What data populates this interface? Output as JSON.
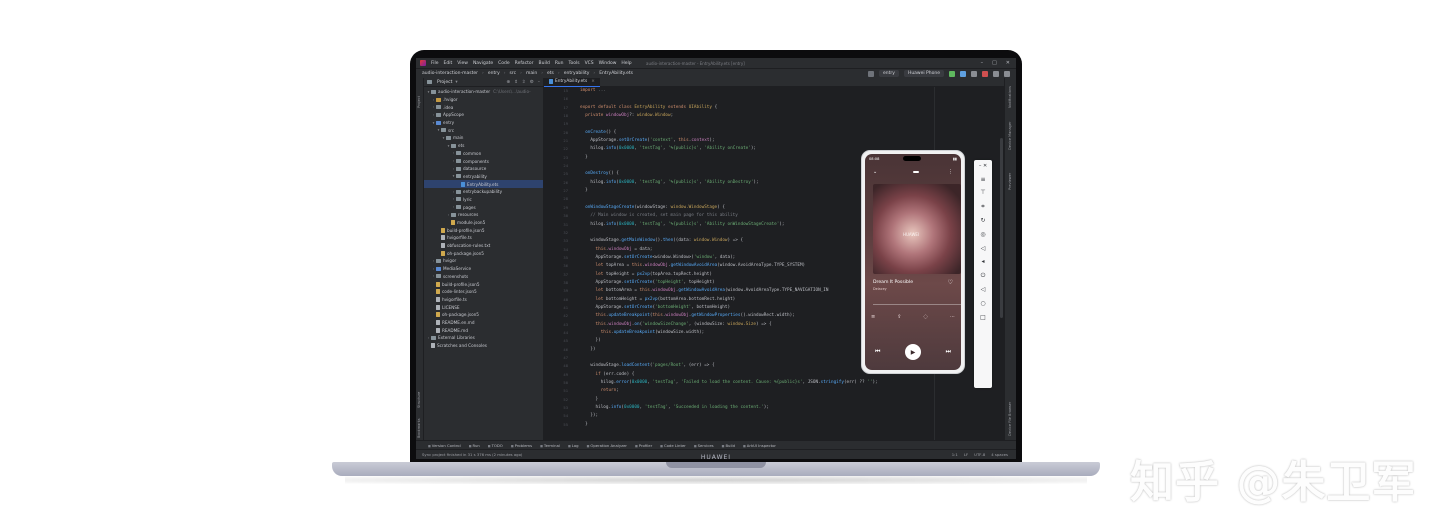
{
  "ide": {
    "menu": [
      "File",
      "Edit",
      "View",
      "Navigate",
      "Code",
      "Refactor",
      "Build",
      "Run",
      "Tools",
      "VCS",
      "Window",
      "Help"
    ],
    "window_title": "audio-interaction-master - EntryAbility.ets [entry]",
    "breadcrumb": [
      "audio-interaction-master",
      "entry",
      "src",
      "main",
      "ets",
      "entryability",
      "EntryAbility.ets"
    ],
    "run_config": "entry",
    "device": "Huawei Phone",
    "left_tools": [
      "Project",
      "Structure",
      "Bookmarks"
    ],
    "right_tools": [
      "Notifications",
      "Device Manager",
      "Previewer",
      "Device File Browser"
    ]
  },
  "project_panel": {
    "title": "Project",
    "tree": [
      {
        "label": "audio-interaction-master",
        "hint": "C:\\Users\\...\\audio-",
        "arrow": "▾",
        "icon": "folder",
        "indent": 0
      },
      {
        "label": ".hvigor",
        "arrow": "›",
        "icon": "folder-y",
        "indent": 1
      },
      {
        "label": ".idea",
        "arrow": "›",
        "icon": "folder",
        "indent": 1
      },
      {
        "label": "AppScope",
        "arrow": "›",
        "icon": "folder",
        "indent": 1
      },
      {
        "label": "entry",
        "arrow": "▾",
        "icon": "folder-b",
        "indent": 1
      },
      {
        "label": "src",
        "arrow": "▾",
        "icon": "folder",
        "indent": 2
      },
      {
        "label": "main",
        "arrow": "▾",
        "icon": "folder",
        "indent": 3
      },
      {
        "label": "ets",
        "arrow": "▾",
        "icon": "folder",
        "indent": 4
      },
      {
        "label": "common",
        "arrow": "›",
        "icon": "folder",
        "indent": 5
      },
      {
        "label": "components",
        "arrow": "›",
        "icon": "folder",
        "indent": 5
      },
      {
        "label": "datasource",
        "arrow": "›",
        "icon": "folder",
        "indent": 5
      },
      {
        "label": "entryability",
        "arrow": "▾",
        "icon": "folder",
        "indent": 5
      },
      {
        "label": "EntryAbility.ets",
        "arrow": "",
        "icon": "file-ts",
        "indent": 6,
        "selected": true
      },
      {
        "label": "entrybackupability",
        "arrow": "›",
        "icon": "folder",
        "indent": 5
      },
      {
        "label": "lyric",
        "arrow": "›",
        "icon": "folder",
        "indent": 5
      },
      {
        "label": "pages",
        "arrow": "›",
        "icon": "folder",
        "indent": 5
      },
      {
        "label": "resources",
        "arrow": "›",
        "icon": "folder",
        "indent": 4
      },
      {
        "label": "module.json5",
        "arrow": "",
        "icon": "file-j",
        "indent": 4
      },
      {
        "label": "build-profile.json5",
        "arrow": "",
        "icon": "file-j",
        "indent": 2
      },
      {
        "label": "hvigorfile.ts",
        "arrow": "",
        "icon": "file",
        "indent": 2
      },
      {
        "label": "obfuscation-rules.txt",
        "arrow": "",
        "icon": "file",
        "indent": 2
      },
      {
        "label": "oh-package.json5",
        "arrow": "",
        "icon": "file-j",
        "indent": 2
      },
      {
        "label": "hvigor",
        "arrow": "›",
        "icon": "folder",
        "indent": 1
      },
      {
        "label": "MediaService",
        "arrow": "›",
        "icon": "folder-b",
        "indent": 1
      },
      {
        "label": "screenshots",
        "arrow": "›",
        "icon": "folder",
        "indent": 1
      },
      {
        "label": "build-profile.json5",
        "arrow": "",
        "icon": "file-j",
        "indent": 1
      },
      {
        "label": "code-linter.json5",
        "arrow": "",
        "icon": "file-j",
        "indent": 1
      },
      {
        "label": "hvigorfile.ts",
        "arrow": "",
        "icon": "file",
        "indent": 1
      },
      {
        "label": "LICENSE",
        "arrow": "",
        "icon": "file",
        "indent": 1
      },
      {
        "label": "oh-package.json5",
        "arrow": "",
        "icon": "file-j",
        "indent": 1
      },
      {
        "label": "README.en.md",
        "arrow": "",
        "icon": "file",
        "indent": 1
      },
      {
        "label": "README.md",
        "arrow": "",
        "icon": "file",
        "indent": 1
      },
      {
        "label": "External Libraries",
        "arrow": "›",
        "icon": "folder",
        "indent": 0
      },
      {
        "label": "Scratches and Consoles",
        "arrow": "",
        "icon": "file",
        "indent": 0
      }
    ]
  },
  "editor": {
    "tab": "EntryAbility.ets",
    "first_line_number": 15
  },
  "toolwindows": [
    "Version Control",
    "Run",
    "TODO",
    "Problems",
    "Terminal",
    "Log",
    "Operation Analyzer",
    "Profiler",
    "Code Linter",
    "Services",
    "Build",
    "ArkUI Inspector"
  ],
  "status": {
    "message": "Sync project finished in 31 s 376 ms (2 minutes ago)",
    "position": "1:1",
    "line_sep": "LF",
    "encoding": "UTF-8",
    "indent": "4 spaces"
  },
  "phone": {
    "time": "08:08",
    "song": "Dream It Possible",
    "artist": "Delacey",
    "cover_mark": "HUAWEI"
  },
  "laptop_brand": "HUAWEI",
  "watermark": "知乎 @朱卫军"
}
